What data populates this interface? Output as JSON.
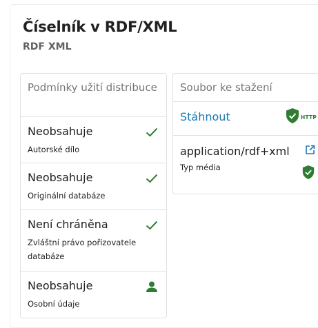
{
  "header": {
    "title": "Číselník v RDF/XML",
    "subtitle": "RDF XML"
  },
  "conditions": {
    "header": "Podmínky užití distribuce",
    "items": [
      {
        "status": "Neobsahuje",
        "label": "Autorské dílo",
        "icon": "check-icon"
      },
      {
        "status": "Neobsahuje",
        "label": "Originální databáze",
        "icon": "check-icon"
      },
      {
        "status": "Není chráněna",
        "label": "Zvláštní právo pořizovatele databáze",
        "icon": "check-icon"
      },
      {
        "status": "Neobsahuje",
        "label": "Osobní údaje",
        "icon": "person-icon"
      }
    ]
  },
  "download": {
    "header": "Soubor ke stažení",
    "link_label": "Stáhnout",
    "badge_text": "HTTP",
    "media_type": "application/rdf+xml",
    "media_type_label": "Typ média"
  },
  "colors": {
    "green": "#2e7d32",
    "link": "#1a7bb5",
    "border": "#e0e0e0"
  }
}
